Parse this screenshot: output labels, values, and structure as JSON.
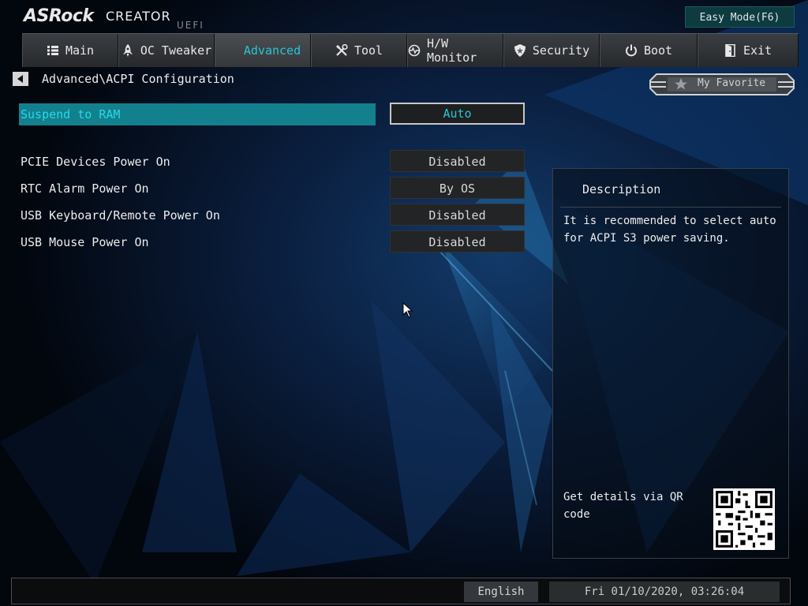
{
  "brand": {
    "name": "ASRock",
    "product": "CREATOR",
    "sub": "UEFI"
  },
  "easy_mode_label": "Easy Mode(F6)",
  "tabs": [
    {
      "label": "Main",
      "icon": "list-icon"
    },
    {
      "label": "OC Tweaker",
      "icon": "rocket-icon"
    },
    {
      "label": "Advanced",
      "icon": "star-icon",
      "active": true
    },
    {
      "label": "Tool",
      "icon": "tools-icon"
    },
    {
      "label": "H/W Monitor",
      "icon": "monitor-icon"
    },
    {
      "label": "Security",
      "icon": "shield-icon"
    },
    {
      "label": "Boot",
      "icon": "power-icon"
    },
    {
      "label": "Exit",
      "icon": "exit-icon"
    }
  ],
  "breadcrumb": "Advanced\\ACPI Configuration",
  "favorite_label": "My Favorite",
  "settings": [
    {
      "label": "Suspend to RAM",
      "value": "Auto",
      "selected": true
    },
    {
      "label": "PCIE Devices Power On",
      "value": "Disabled"
    },
    {
      "label": "RTC Alarm Power On",
      "value": "By OS"
    },
    {
      "label": "USB Keyboard/Remote Power On",
      "value": "Disabled"
    },
    {
      "label": "USB Mouse Power On",
      "value": "Disabled"
    }
  ],
  "description": {
    "title": "Description",
    "text": "It is recommended to select auto for ACPI S3 power saving.",
    "qr_text": "Get details via QR code"
  },
  "footer": {
    "language": "English",
    "datetime": "Fri 01/10/2020, 03:26:04"
  },
  "colors": {
    "accent": "#27c6d6",
    "selected_row": "#13808e"
  }
}
